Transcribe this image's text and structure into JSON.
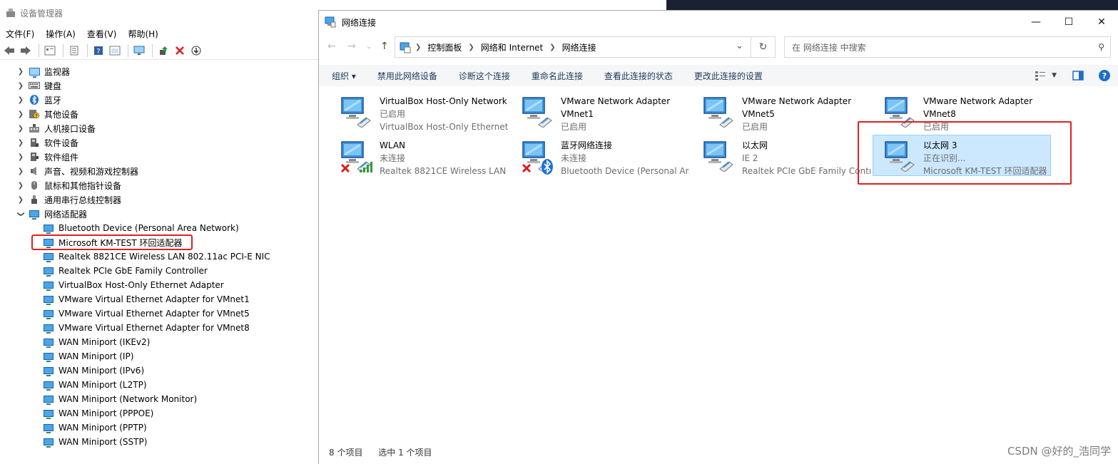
{
  "device_manager": {
    "title": "设备管理器",
    "menu": [
      "文件(F)",
      "操作(A)",
      "查看(V)",
      "帮助(H)"
    ],
    "categories": [
      {
        "label": "监视器",
        "expanded": false
      },
      {
        "label": "键盘",
        "expanded": false
      },
      {
        "label": "蓝牙",
        "expanded": false
      },
      {
        "label": "其他设备",
        "expanded": false
      },
      {
        "label": "人机接口设备",
        "expanded": false
      },
      {
        "label": "软件设备",
        "expanded": false
      },
      {
        "label": "软件组件",
        "expanded": false
      },
      {
        "label": "声音、视频和游戏控制器",
        "expanded": false
      },
      {
        "label": "鼠标和其他指针设备",
        "expanded": false
      },
      {
        "label": "通用串行总线控制器",
        "expanded": false
      },
      {
        "label": "网络适配器",
        "expanded": true
      }
    ],
    "network_adapters": [
      "Bluetooth Device (Personal Area Network)",
      "Microsoft KM-TEST 环回适配器",
      "Realtek 8821CE Wireless LAN 802.11ac PCI-E NIC",
      "Realtek PCIe GbE Family Controller",
      "VirtualBox Host-Only Ethernet Adapter",
      "VMware Virtual Ethernet Adapter for VMnet1",
      "VMware Virtual Ethernet Adapter for VMnet5",
      "VMware Virtual Ethernet Adapter for VMnet8",
      "WAN Miniport (IKEv2)",
      "WAN Miniport (IP)",
      "WAN Miniport (IPv6)",
      "WAN Miniport (L2TP)",
      "WAN Miniport (Network Monitor)",
      "WAN Miniport (PPPOE)",
      "WAN Miniport (PPTP)",
      "WAN Miniport (SSTP)"
    ]
  },
  "network_connections": {
    "title": "网络连接",
    "breadcrumb": [
      "控制面板",
      "网络和 Internet",
      "网络连接"
    ],
    "search_placeholder": "在 网络连接 中搜索",
    "commands": [
      "组织 ▾",
      "禁用此网络设备",
      "诊断这个连接",
      "重命名此连接",
      "查看此连接的状态",
      "更改此连接的设置"
    ],
    "items": [
      {
        "name": "VirtualBox Host-Only Network",
        "line2": "已启用",
        "line3": "VirtualBox Host-Only Ethernet ...",
        "badge": "none"
      },
      {
        "name": "VMware Network Adapter",
        "line2": "VMnet1",
        "line3": "已启用",
        "badge": "none",
        "name_dark_line2": true
      },
      {
        "name": "VMware Network Adapter",
        "line2": "VMnet5",
        "line3": "已启用",
        "badge": "none",
        "name_dark_line2": true
      },
      {
        "name": "VMware Network Adapter",
        "line2": "VMnet8",
        "line3": "已启用",
        "badge": "none",
        "name_dark_line2": true
      },
      {
        "name": "WLAN",
        "line2": "未连接",
        "line3": "Realtek 8821CE Wireless LAN ...",
        "badge": "wifi-disconnected"
      },
      {
        "name": "蓝牙网络连接",
        "line2": "未连接",
        "line3": "Bluetooth Device (Personal Ar...",
        "badge": "bluetooth-disconnected"
      },
      {
        "name": "以太网",
        "line2": "IE 2",
        "line3": "Realtek PCIe GbE Family Contr...",
        "badge": "none"
      },
      {
        "name": "以太网 3",
        "line2": "正在识别...",
        "line3": "Microsoft KM-TEST 环回适配器",
        "badge": "none",
        "selected": true
      }
    ],
    "status": {
      "count": "8 个项目",
      "selected": "选中 1 个项目"
    }
  },
  "watermark": "CSDN @好的_浩同学",
  "colors": {
    "highlight_red": "#e02020",
    "selection": "#cce8ff",
    "accent_blue": "#1e6fc8"
  }
}
